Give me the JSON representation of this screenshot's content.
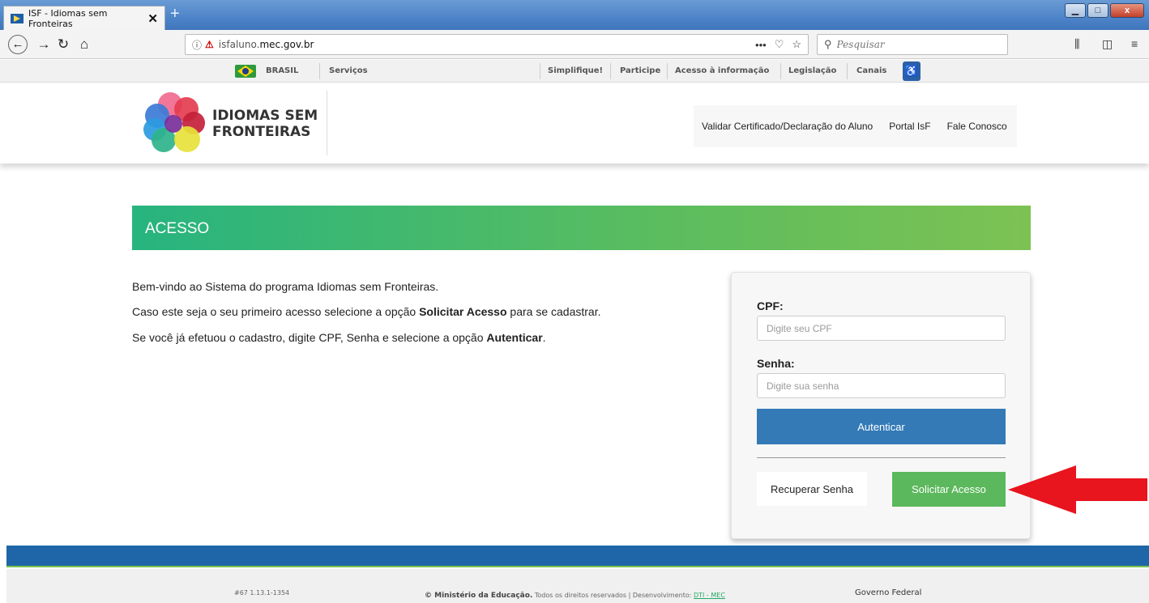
{
  "browser": {
    "tab_title": "ISF - Idiomas sem Fronteiras",
    "tab_close": "✕",
    "new_tab": "+",
    "url_prefix": "isfaluno.",
    "url_domain": "mec.gov.br",
    "url_actions": "•••",
    "search_placeholder": "Pesquisar"
  },
  "govbar": {
    "brasil": "BRASIL",
    "servicos": "Serviços",
    "simplifique": "Simplifique!",
    "participe": "Participe",
    "acesso_info": "Acesso à informação",
    "legislacao": "Legislação",
    "canais": "Canais"
  },
  "header": {
    "logo_line1": "IDIOMAS SEM",
    "logo_line2": "FRONTEIRAS",
    "nav": [
      "Validar Certificado/Declaração do Aluno",
      "Portal IsF",
      "Fale Conosco"
    ]
  },
  "main": {
    "banner_title": "ACESSO",
    "p1": "Bem-vindo ao Sistema do programa Idiomas sem Fronteiras.",
    "p2_a": "Caso este seja o seu primeiro acesso selecione a opção ",
    "p2_b": "Solicitar Acesso",
    "p2_c": " para se cadastrar.",
    "p3_a": "Se você já efetuou o cadastro, digite CPF, Senha e selecione a opção ",
    "p3_b": "Autenticar",
    "p3_c": "."
  },
  "login": {
    "cpf_label": "CPF:",
    "cpf_placeholder": "Digite seu CPF",
    "senha_label": "Senha:",
    "senha_placeholder": "Digite sua senha",
    "autenticar": "Autenticar",
    "recuperar": "Recuperar Senha",
    "solicitar": "Solicitar Acesso"
  },
  "footer": {
    "build": "#67  1.13.1-1354",
    "copyright_bold": "© Ministério da Educação.",
    "copyright_rest": " Todos os direitos reservados | Desenvolvimento: ",
    "dev_link": "DTI - MEC",
    "gov": "Governo Federal"
  },
  "colors": {
    "primary_button": "#337ab7",
    "success_button": "#5cb85c",
    "annotation_arrow": "#e8141e",
    "footer_blue": "#1e66a7"
  }
}
